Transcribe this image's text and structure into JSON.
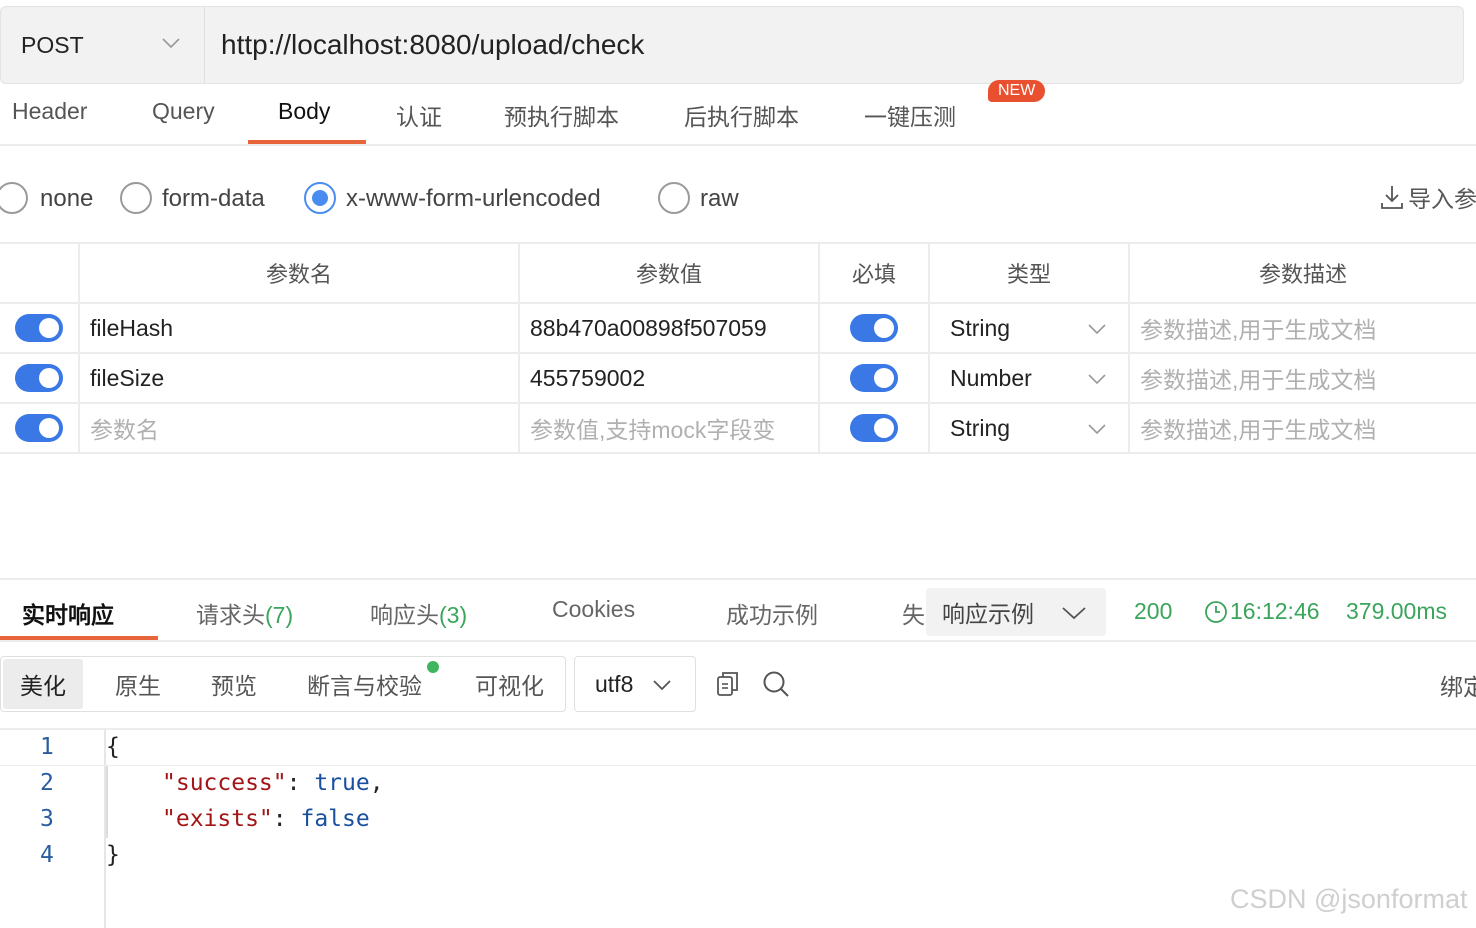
{
  "request": {
    "method": "POST",
    "url": "http://localhost:8080/upload/check"
  },
  "request_tabs": [
    {
      "label": "Header"
    },
    {
      "label": "Query"
    },
    {
      "label": "Body",
      "active": true
    },
    {
      "label": "认证"
    },
    {
      "label": "预执行脚本"
    },
    {
      "label": "后执行脚本"
    },
    {
      "label": "一键压测"
    }
  ],
  "new_badge": "NEW",
  "body_types": [
    {
      "label": "none",
      "checked": false
    },
    {
      "label": "form-data",
      "checked": false
    },
    {
      "label": "x-www-form-urlencoded",
      "checked": true
    },
    {
      "label": "raw",
      "checked": false
    }
  ],
  "import_label": "导入参",
  "params_table": {
    "headers": [
      "参数名",
      "参数值",
      "必填",
      "类型",
      "参数描述"
    ],
    "rows": [
      {
        "enabled": true,
        "name": "fileHash",
        "value": "88b470a00898f507059",
        "required": true,
        "type": "String",
        "description_placeholder": "参数描述,用于生成文档"
      },
      {
        "enabled": true,
        "name": "fileSize",
        "value": "455759002",
        "required": true,
        "type": "Number",
        "description_placeholder": "参数描述,用于生成文档"
      },
      {
        "enabled": true,
        "name_placeholder": "参数名",
        "value_placeholder": "参数值,支持mock字段变",
        "required": true,
        "type": "String",
        "description_placeholder": "参数描述,用于生成文档"
      }
    ]
  },
  "response_tabs": [
    {
      "label": "实时响应",
      "active": true
    },
    {
      "label": "请求头",
      "count": "(7)"
    },
    {
      "label": "响应头",
      "count": "(3)"
    },
    {
      "label": "Cookies"
    },
    {
      "label": "成功示例"
    },
    {
      "label": "失"
    }
  ],
  "response_example_select": "响应示例",
  "response_status": {
    "code": "200",
    "time": "16:12:46",
    "duration": "379.00ms"
  },
  "format_buttons": [
    {
      "label": "美化",
      "active": true
    },
    {
      "label": "原生"
    },
    {
      "label": "预览"
    },
    {
      "label": "断言与校验"
    },
    {
      "label": "可视化"
    }
  ],
  "encoding": "utf8",
  "bind_label": "绑定",
  "code_lines": [
    {
      "num": "1",
      "text": "{"
    },
    {
      "num": "2",
      "key": "\"success\"",
      "sep": ": ",
      "val": "true",
      "end": ","
    },
    {
      "num": "3",
      "key": "\"exists\"",
      "sep": ": ",
      "val": "false",
      "end": ""
    },
    {
      "num": "4",
      "text": "}"
    }
  ],
  "watermark": "CSDN @jsonformat",
  "colors": {
    "accent": "#e8643a",
    "toggle": "#3a78e6",
    "radio": "#4a8df2",
    "status_green": "#3aa55b",
    "new_badge": "#e8502f"
  }
}
